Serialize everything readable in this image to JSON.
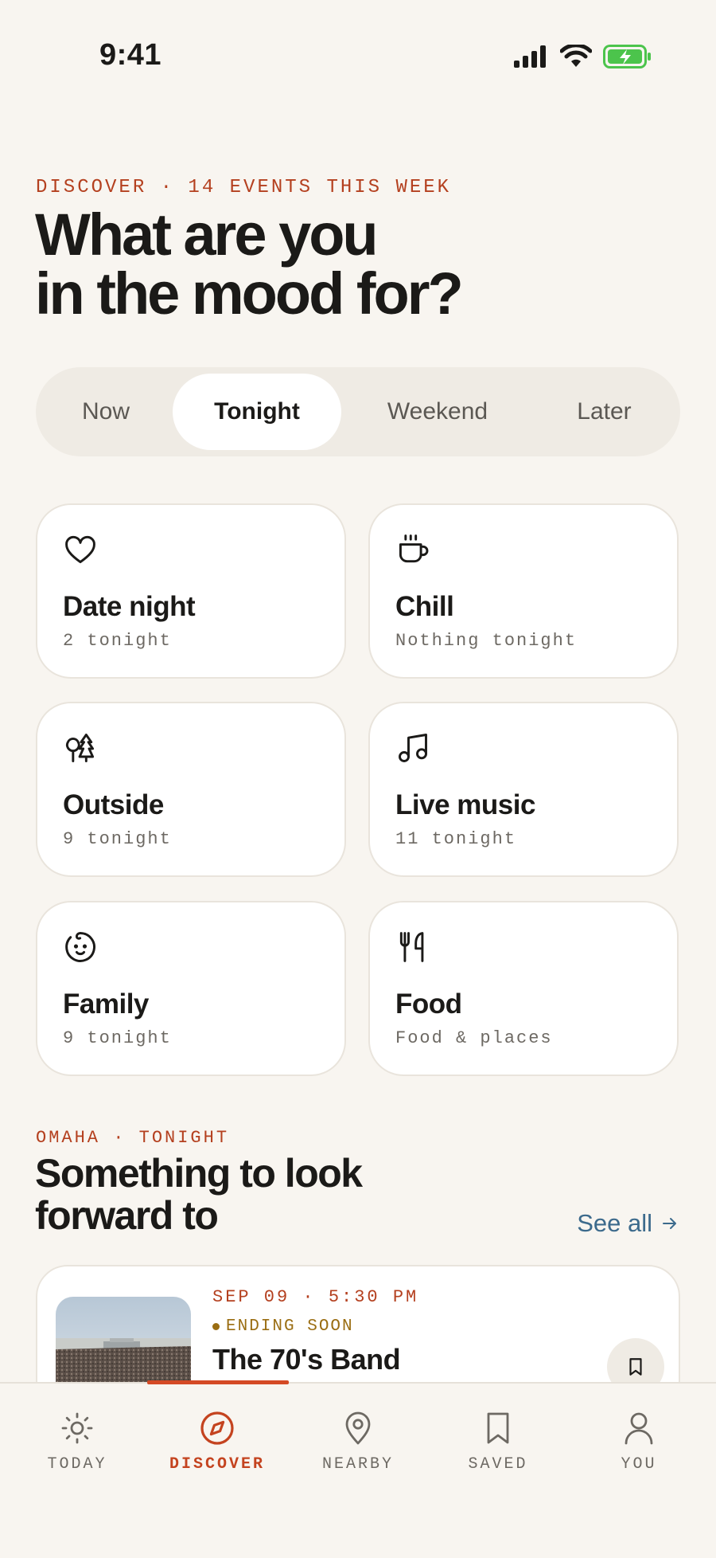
{
  "status_bar": {
    "time": "9:41"
  },
  "header": {
    "eyebrow": "DISCOVER · 14 EVENTS THIS WEEK",
    "title_line1": "What are you",
    "title_line2": "in the mood for?"
  },
  "segments": {
    "items": [
      "Now",
      "Tonight",
      "Weekend",
      "Later"
    ],
    "selected": "Tonight"
  },
  "moods": [
    {
      "title": "Date night",
      "subtitle": "2 tonight",
      "icon": "heart-icon"
    },
    {
      "title": "Chill",
      "subtitle": "Nothing tonight",
      "icon": "coffee-cup-icon"
    },
    {
      "title": "Outside",
      "subtitle": "9 tonight",
      "icon": "trees-icon"
    },
    {
      "title": "Live music",
      "subtitle": "11 tonight",
      "icon": "music-note-icon"
    },
    {
      "title": "Family",
      "subtitle": "9 tonight",
      "icon": "baby-face-icon"
    },
    {
      "title": "Food",
      "subtitle": "Food & places",
      "icon": "fork-knife-icon"
    }
  ],
  "section": {
    "eyebrow": "OMAHA · TONIGHT",
    "title_line1": "Something to look",
    "title_line2": "forward to",
    "see_all": "See all"
  },
  "event": {
    "date": "SEP 09 · 5:30 PM",
    "tag": "ENDING SOON",
    "name": "The 70's Band"
  },
  "nav": {
    "items": [
      {
        "label": "TODAY",
        "icon": "sun-icon"
      },
      {
        "label": "DISCOVER",
        "icon": "compass-icon"
      },
      {
        "label": "NEARBY",
        "icon": "map-pin-icon"
      },
      {
        "label": "SAVED",
        "icon": "bookmark-icon"
      },
      {
        "label": "YOU",
        "icon": "user-icon"
      }
    ],
    "active": "DISCOVER"
  },
  "colors": {
    "background": "#f8f5f0",
    "accent": "#c4431f",
    "link": "#3c6a8c",
    "ending_soon": "#9a6d12",
    "battery_green": "#4cc44c"
  }
}
